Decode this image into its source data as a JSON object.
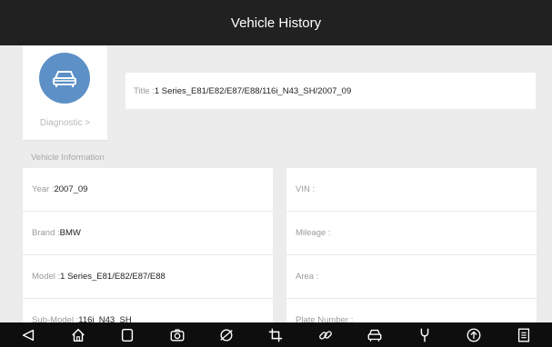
{
  "header": {
    "title": "Vehicle History"
  },
  "diagnostic": {
    "icon": "car-icon",
    "label": "Diagnostic >"
  },
  "title_field": {
    "label": "Title : ",
    "value": "1 Series_E81/E82/E87/E88/116i_N43_SH/2007_09"
  },
  "vehicle_info": {
    "section_label": "Vehicle Information",
    "left": [
      {
        "label": "Year : ",
        "value": "2007_09"
      },
      {
        "label": "Brand : ",
        "value": "BMW"
      },
      {
        "label": "Model : ",
        "value": "1 Series_E81/E82/E87/E88"
      },
      {
        "label": "Sub-Model : ",
        "value": "116i_N43_SH"
      }
    ],
    "right": [
      {
        "label": "VIN :",
        "value": ""
      },
      {
        "label": "Mileage :",
        "value": ""
      },
      {
        "label": "Area :",
        "value": ""
      },
      {
        "label": "Plate Number :",
        "value": ""
      }
    ]
  },
  "navbar": {
    "icons": [
      "back-icon",
      "home-icon",
      "recent-apps-icon",
      "camera-icon",
      "browser-icon",
      "crop-icon",
      "link-icon",
      "car-icon",
      "wrench-icon",
      "upload-icon",
      "document-icon"
    ]
  },
  "colors": {
    "header_bg": "#212121",
    "accent": "#5d90c7",
    "navbar_bg": "#0e0e0e",
    "background": "#ebebeb"
  }
}
